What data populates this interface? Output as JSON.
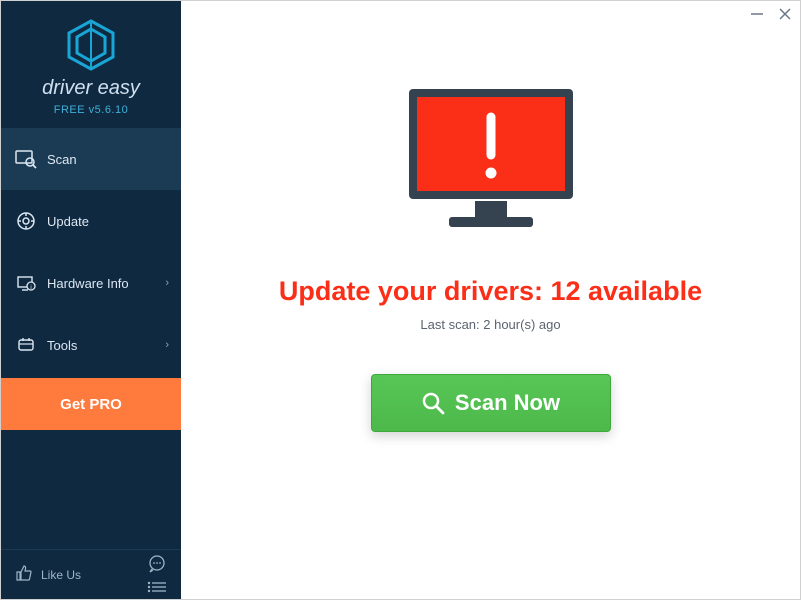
{
  "brand": {
    "name": "driver easy",
    "version": "FREE v5.6.10"
  },
  "sidebar": {
    "items": [
      {
        "label": "Scan"
      },
      {
        "label": "Update"
      },
      {
        "label": "Hardware Info"
      },
      {
        "label": "Tools"
      }
    ],
    "getpro_label": "Get PRO",
    "likeus_label": "Like Us"
  },
  "main": {
    "headline": "Update your drivers: 12 available",
    "subline": "Last scan: 2 hour(s) ago",
    "scan_button": "Scan Now"
  }
}
